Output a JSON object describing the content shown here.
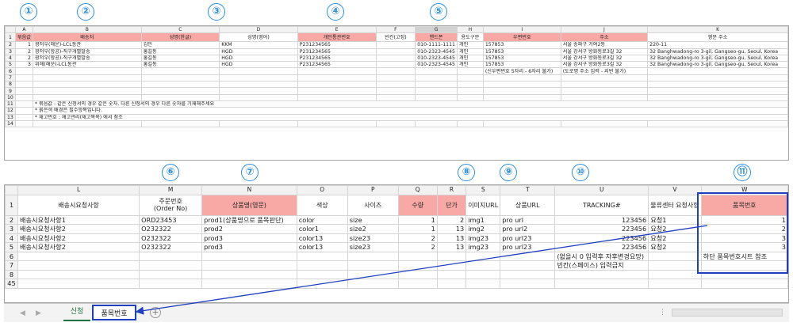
{
  "markers": [
    "①",
    "②",
    "③",
    "④",
    "⑤",
    "⑥",
    "⑦",
    "⑧",
    "⑨",
    "⑩",
    "⑪"
  ],
  "sheet1": {
    "cols": [
      "",
      "A",
      "B",
      "C",
      "D",
      "E",
      "F",
      "G",
      "H",
      "I",
      "J",
      "K"
    ],
    "header": [
      "1",
      "묶음값",
      "배송처",
      "성명(한글)",
      "성명(영어)",
      "개인통관번호",
      "빈칸(고정)",
      "핸드폰",
      "용도구분",
      "우편번호",
      "주소",
      "영문 주소"
    ],
    "rows": [
      [
        "2",
        "1",
        "광저우(해운)-LCL통관",
        "김민",
        "KKM",
        "P231234565",
        "",
        "010-1111-1111",
        "개인",
        "157853",
        "서울 송파구 거여2동",
        "220-11"
      ],
      [
        "3",
        "2",
        "광저우(항공)-직구개별발송",
        "홍길동",
        "HGD",
        "P231234565",
        "",
        "010-2323-4545",
        "개인",
        "157853",
        "서울 강서구 방화동로3길 32",
        "32 Banghwadong-ro 3-gil, Gangseo-gu, Seoul, Korea"
      ],
      [
        "4",
        "2",
        "광저우(항공)-직구개별발송",
        "홍길동",
        "HGD",
        "P231234565",
        "",
        "010-2323-4545",
        "개인",
        "157853",
        "서울 강서구 방화동로3길 32",
        "32 Banghwadong-ro 3-gil, Gangseo-gu, Seoul, Korea"
      ],
      [
        "5",
        "3",
        "위해(해운)-LCL통관",
        "홍길동",
        "HGD",
        "P231234565",
        "",
        "010-2323-4545",
        "개인",
        "157853",
        "서울 강서구 방화동로3길 32",
        "32 Banghwadong-ro 3-gil, Gangseo-gu, Seoul, Korea"
      ]
    ],
    "row6_notes": [
      "(신우편번호 5자리 - 6자리 불가)",
      "(도로명 주소 입력 - 지번 불가)"
    ],
    "empty_rows": [
      "7",
      "8",
      "9",
      "10",
      "14"
    ],
    "notes": [
      {
        "row": "11",
        "text": "* 묶음값 : 같은 신청서의 경우 같은 숫자, 다른 신청서의 경우 다른 숫자를 기재해주세요"
      },
      {
        "row": "12",
        "text": "* 붉은색 배경은 필수항목입니다."
      },
      {
        "row": "13",
        "text": "* 재고번호 : 재고관리(재고목록) 에서 참조"
      }
    ]
  },
  "sheet2": {
    "cols": [
      "",
      "L",
      "M",
      "N",
      "O",
      "P",
      "Q",
      "R",
      "S",
      "T",
      "U",
      "V",
      "W"
    ],
    "header": [
      "1",
      "배송시요청사항",
      "주문번호\n(Order No)",
      "상품명(영문)",
      "색상",
      "사이즈",
      "수량",
      "단가",
      "이미지URL",
      "상품URL",
      "TRACKING#",
      "물류센터 요청사항",
      "품목번호"
    ],
    "rows": [
      [
        "2",
        "배송시요청사항1",
        "ORD23453",
        "prod1(상품명으로 품목판단)",
        "color",
        "size",
        "1",
        "2",
        "img1",
        "pro url",
        "123456",
        "요청1",
        "1"
      ],
      [
        "3",
        "배송시요청사항2",
        "O232322",
        "prod2",
        "color1",
        "size2",
        "1",
        "13",
        "img2",
        "pro url2",
        "223456",
        "요청2",
        "2"
      ],
      [
        "4",
        "배송시요청사항2",
        "O232322",
        "prod3",
        "color13",
        "size23",
        "2",
        "13",
        "img23",
        "pro url23",
        "223456",
        "요청2",
        "3"
      ],
      [
        "5",
        "배송시요청사항2",
        "O232322",
        "prod3",
        "color13",
        "size23",
        "2",
        "13",
        "img23",
        "pro url23",
        "223456",
        "요청2",
        "3"
      ]
    ],
    "rownums_after": [
      "6",
      "7",
      "8",
      "45"
    ],
    "tracking_note1": "(없을시 0 입력후 자후변경요망)",
    "tracking_note2": "빈칸(스페이스) 입력금지",
    "w_note": "하단 품목번호시트 참조"
  },
  "tabs": {
    "sheet_tab1": "신청",
    "sheet_tab2": "품목번호"
  },
  "colors": {
    "required_header": "#f8a9a6",
    "marker": "#2b8de0",
    "annotation": "#1f3fbf",
    "note_red": "#c00000"
  }
}
